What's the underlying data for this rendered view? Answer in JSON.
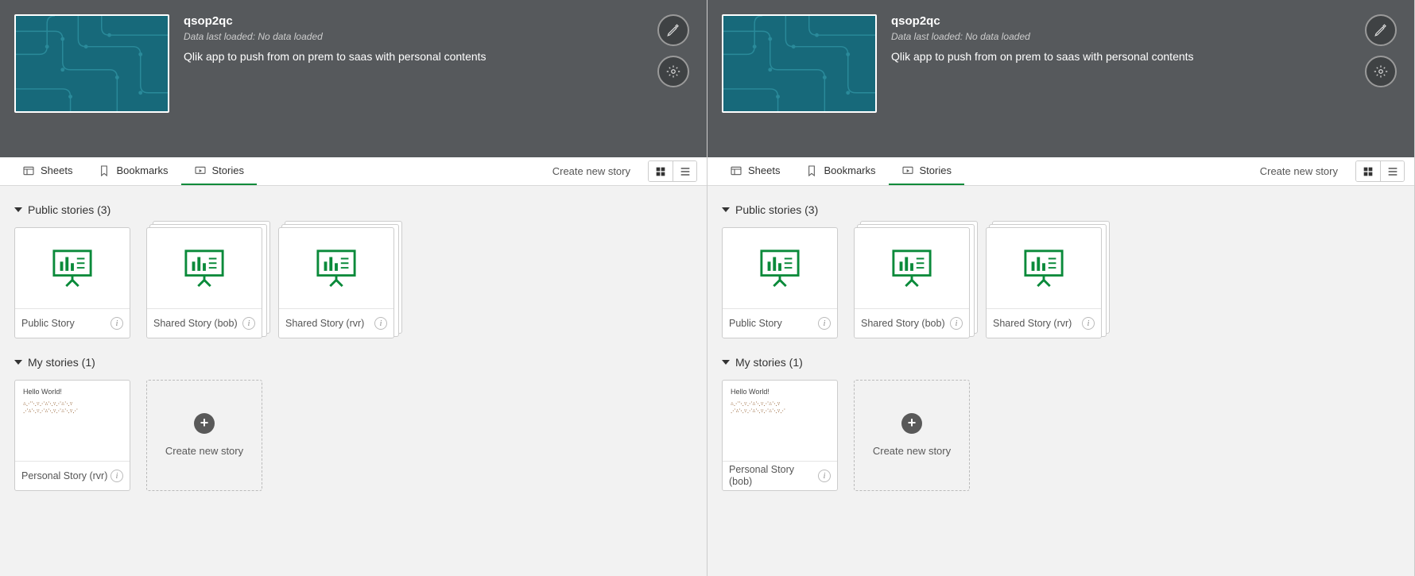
{
  "panes": [
    {
      "app": {
        "title": "qsop2qc",
        "data_loaded": "Data last loaded: No data loaded",
        "description": "Qlik app to push from on prem to saas with personal contents"
      },
      "tabs": {
        "sheets": "Sheets",
        "bookmarks": "Bookmarks",
        "stories": "Stories",
        "create_link": "Create new story"
      },
      "sections": {
        "public": {
          "title": "Public stories (3)"
        },
        "my": {
          "title": "My stories (1)"
        }
      },
      "public_stories": [
        {
          "name": "Public Story"
        },
        {
          "name": "Shared Story (bob)"
        },
        {
          "name": "Shared Story (rvr)"
        }
      ],
      "my_story": {
        "name": "Personal Story (rvr)",
        "slide_title": "Hello World!",
        "slide_body": "corrupted text sample content"
      },
      "create_card": "Create new story"
    },
    {
      "app": {
        "title": "qsop2qc",
        "data_loaded": "Data last loaded: No data loaded",
        "description": "Qlik app to push from on prem to saas with personal contents"
      },
      "tabs": {
        "sheets": "Sheets",
        "bookmarks": "Bookmarks",
        "stories": "Stories",
        "create_link": "Create new story"
      },
      "sections": {
        "public": {
          "title": "Public stories (3)"
        },
        "my": {
          "title": "My stories (1)"
        }
      },
      "public_stories": [
        {
          "name": "Public Story"
        },
        {
          "name": "Shared Story (bob)"
        },
        {
          "name": "Shared Story (rvr)"
        }
      ],
      "my_story": {
        "name": "Personal Story (bob)",
        "slide_title": "Hello World!",
        "slide_body": "corrupted text sample content"
      },
      "create_card": "Create new story"
    }
  ]
}
